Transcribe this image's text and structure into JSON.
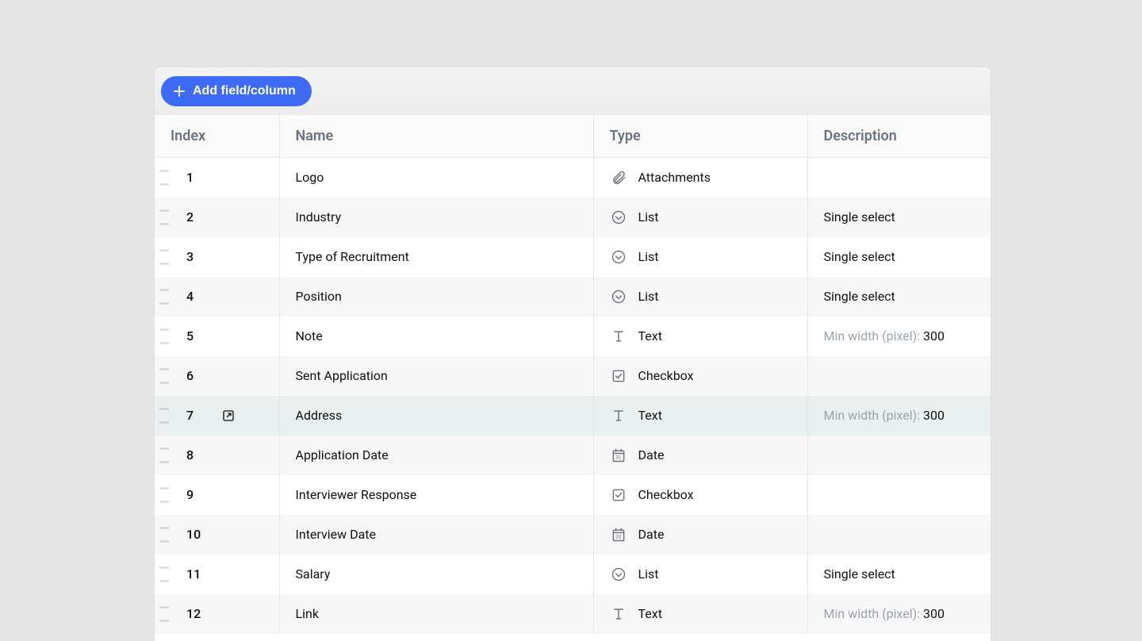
{
  "toolbar": {
    "add_label": "Add field/column"
  },
  "columns": {
    "index": "Index",
    "name": "Name",
    "type": "Type",
    "description": "Description"
  },
  "desc_labels": {
    "min_width": "Min width (pixel): "
  },
  "rows": [
    {
      "index": "1",
      "name": "Logo",
      "type_icon": "attach",
      "type": "Attachments",
      "desc_kind": "none"
    },
    {
      "index": "2",
      "name": "Industry",
      "type_icon": "list",
      "type": "List",
      "desc_kind": "plain",
      "desc": "Single select"
    },
    {
      "index": "3",
      "name": "Type of Recruitment",
      "type_icon": "list",
      "type": "List",
      "desc_kind": "plain",
      "desc": "Single select"
    },
    {
      "index": "4",
      "name": "Position",
      "type_icon": "list",
      "type": "List",
      "desc_kind": "plain",
      "desc": "Single select"
    },
    {
      "index": "5",
      "name": "Note",
      "type_icon": "text",
      "type": "Text",
      "desc_kind": "minw",
      "desc_value": "300"
    },
    {
      "index": "6",
      "name": "Sent Application",
      "type_icon": "checkbox",
      "type": "Checkbox",
      "desc_kind": "none"
    },
    {
      "index": "7",
      "name": "Address",
      "type_icon": "text",
      "type": "Text",
      "desc_kind": "minw",
      "desc_value": "300",
      "selected": true
    },
    {
      "index": "8",
      "name": "Application Date",
      "type_icon": "date",
      "type": "Date",
      "desc_kind": "none"
    },
    {
      "index": "9",
      "name": "Interviewer Response",
      "type_icon": "checkbox",
      "type": "Checkbox",
      "desc_kind": "none"
    },
    {
      "index": "10",
      "name": "Interview Date",
      "type_icon": "date",
      "type": "Date",
      "desc_kind": "none"
    },
    {
      "index": "11",
      "name": "Salary",
      "type_icon": "list",
      "type": "List",
      "desc_kind": "plain",
      "desc": "Single select"
    },
    {
      "index": "12",
      "name": "Link",
      "type_icon": "text",
      "type": "Text",
      "desc_kind": "minw",
      "desc_value": "300"
    }
  ]
}
